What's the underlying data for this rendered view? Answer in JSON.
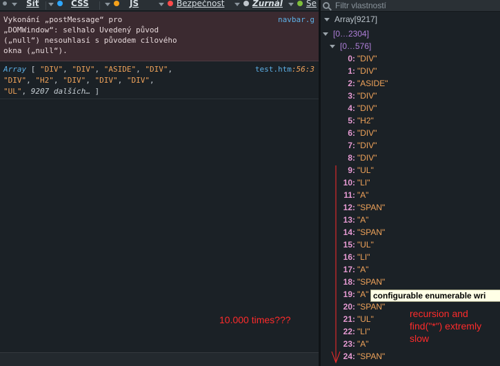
{
  "toolbar": {
    "items": [
      {
        "label": "Síť",
        "dot": "",
        "icon": "network-icon"
      },
      {
        "label": "CSS",
        "dot": "#2ea7ff",
        "icon": "css-icon"
      },
      {
        "label": "JS",
        "dot": "#f6a11a",
        "icon": "js-icon"
      },
      {
        "label": "Bezpečnost",
        "dot": "#ff4a4a",
        "icon": "security-icon"
      },
      {
        "label": "Žurnál",
        "dot": "#c0c6cc",
        "icon": "logging-icon"
      },
      {
        "label": "Se",
        "dot": "#7fbf3a",
        "icon": "server-icon"
      }
    ]
  },
  "console": {
    "error": {
      "lines": [
        "Vykonání „postMessage“ pro",
        "„DOMWindow“: selhalo Uvedený původ",
        "(„null“) nesouhlasí s původem cílového",
        "okna („null“)."
      ],
      "source": "navbar.g"
    },
    "log": {
      "keyword": "Array",
      "items": [
        "\"DIV\"",
        "\"DIV\"",
        "\"ASIDE\"",
        "\"DIV\"",
        "\"DIV\"",
        "\"H2\"",
        "\"DIV\"",
        "\"DIV\"",
        "\"DIV\"",
        "\"UL\""
      ],
      "more": "9207 dalších…",
      "source_file": "test.htm",
      "source_line": ":56:3"
    },
    "annotation": "10.000 times???"
  },
  "props": {
    "filter_placeholder": "Filtr vlastností",
    "root_label": "Array[9217]",
    "range1": "[0…2304]",
    "range2": "[0…576]",
    "rows": [
      {
        "i": "0:",
        "v": "\"DIV\""
      },
      {
        "i": "1:",
        "v": "\"DIV\""
      },
      {
        "i": "2:",
        "v": "\"ASIDE\""
      },
      {
        "i": "3:",
        "v": "\"DIV\""
      },
      {
        "i": "4:",
        "v": "\"DIV\""
      },
      {
        "i": "5:",
        "v": "\"H2\""
      },
      {
        "i": "6:",
        "v": "\"DIV\""
      },
      {
        "i": "7:",
        "v": "\"DIV\""
      },
      {
        "i": "8:",
        "v": "\"DIV\""
      },
      {
        "i": "9:",
        "v": "\"UL\""
      },
      {
        "i": "10:",
        "v": "\"LI\""
      },
      {
        "i": "11:",
        "v": "\"A\""
      },
      {
        "i": "12:",
        "v": "\"SPAN\""
      },
      {
        "i": "13:",
        "v": "\"A\""
      },
      {
        "i": "14:",
        "v": "\"SPAN\""
      },
      {
        "i": "15:",
        "v": "\"UL\""
      },
      {
        "i": "16:",
        "v": "\"LI\""
      },
      {
        "i": "17:",
        "v": "\"A\""
      },
      {
        "i": "18:",
        "v": "\"SPAN\""
      },
      {
        "i": "19:",
        "v": "\"A\""
      },
      {
        "i": "20:",
        "v": "\"SPAN\""
      },
      {
        "i": "21:",
        "v": "\"UL\""
      },
      {
        "i": "22:",
        "v": "\"LI\""
      },
      {
        "i": "23:",
        "v": "\"A\""
      },
      {
        "i": "24:",
        "v": "\"SPAN\""
      }
    ],
    "tooltip": "configurable enumerable wri",
    "annotation": "recursion and\nfind(\"*\") extremly\nslow"
  },
  "colors": {
    "annotation": "#ff2b2b",
    "string": "#f0a35a",
    "index": "#e59ad2",
    "range": "#b07fdb",
    "link": "#5db0e6"
  }
}
